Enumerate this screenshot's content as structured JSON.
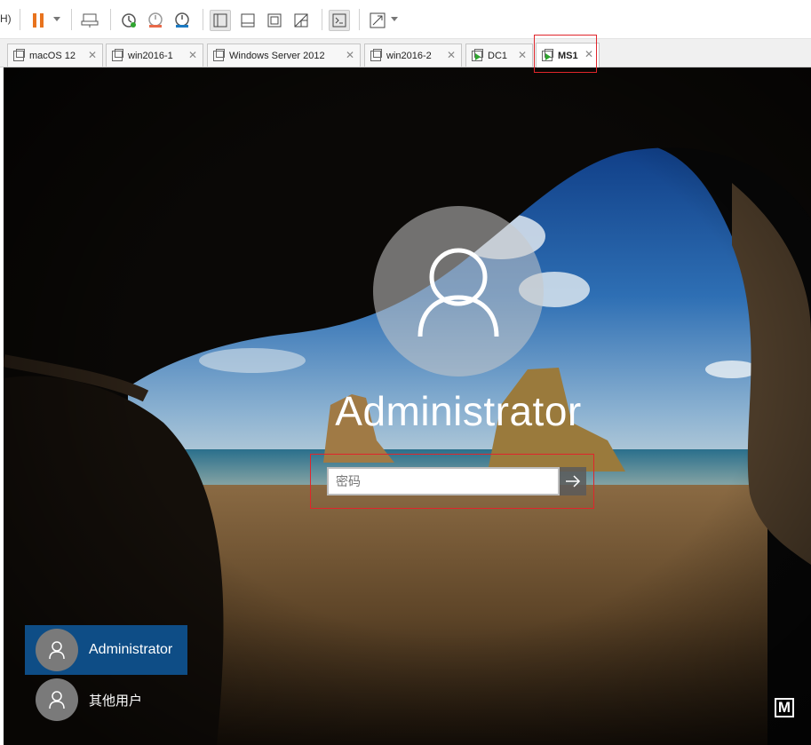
{
  "toolbar": {
    "icons": [
      "menu-fragment",
      "pause-icon",
      "send-ctrl-alt-del-icon",
      "snapshot-take-icon",
      "snapshot-revert-icon",
      "snapshot-manager-icon",
      "library-view-icon",
      "thumbnail-view-icon",
      "fullscreen-icon",
      "unity-icon",
      "console-icon",
      "stretch-icon"
    ],
    "fragment_label": "H)"
  },
  "tabs": [
    {
      "label": "macOS 12",
      "running": false
    },
    {
      "label": "win2016-1",
      "running": false
    },
    {
      "label": "Windows Server 2012",
      "running": false
    },
    {
      "label": "win2016-2",
      "running": false
    },
    {
      "label": "DC1",
      "running": true
    },
    {
      "label": "MS1",
      "running": true,
      "active": true
    }
  ],
  "login": {
    "username": "Administrator",
    "password_placeholder": "密码"
  },
  "user_list": [
    {
      "name": "Administrator",
      "selected": true
    },
    {
      "name": "其他用户",
      "selected": false
    }
  ],
  "corner_logo": "M",
  "colors": {
    "highlight": "#e0252b",
    "selected_user": "#0e4d86",
    "pause": "#e8731e"
  }
}
